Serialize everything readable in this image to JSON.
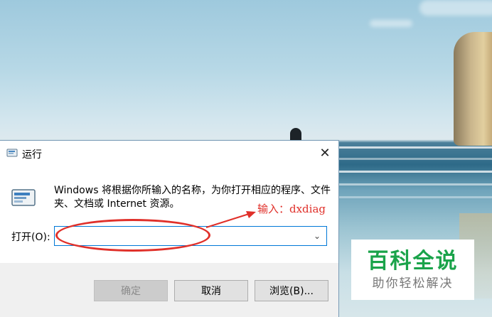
{
  "dialog": {
    "title": "运行",
    "description": "Windows 将根据你所输入的名称，为你打开相应的程序、文件夹、文档或 Internet 资源。",
    "open_label": "打开(O):",
    "open_value": "",
    "buttons": {
      "ok": "确定",
      "cancel": "取消",
      "browse": "浏览(B)..."
    },
    "ok_enabled": false
  },
  "annotation": {
    "text": "输入：dxdiag",
    "color": "#e0302a"
  },
  "watermark": {
    "title": "百科全说",
    "subtitle": "助你轻松解决",
    "color": "#1aa34a"
  },
  "icons": {
    "title": "run-icon",
    "body": "run-icon",
    "close": "close-icon",
    "dropdown": "chevron-down-icon"
  }
}
